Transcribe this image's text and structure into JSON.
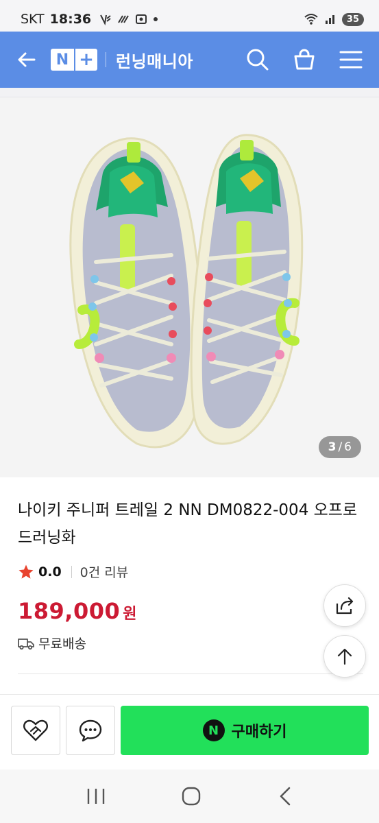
{
  "status_bar": {
    "carrier": "SKT",
    "time": "18:36",
    "battery": "35"
  },
  "header": {
    "logo_n": "N",
    "logo_plus": "+",
    "store_name": "런닝매니아",
    "icons": [
      "back-arrow-icon",
      "search-icon",
      "cart-icon",
      "menu-icon"
    ]
  },
  "gallery": {
    "current": "3",
    "separator": "/",
    "total": "6"
  },
  "product": {
    "title": "나이키 주니퍼 트레일 2 NN DM0822-004 오프로드러닝화",
    "rating": "0.0",
    "review_count": "0건 리뷰",
    "price": "189,000",
    "price_unit": "원",
    "shipping": "무료배송"
  },
  "actions": {
    "buy_label": "구매하기",
    "npay_badge": "N"
  },
  "colors": {
    "header_bg": "#5b8de5",
    "price": "#cc1a33",
    "buy_button": "#22e05a",
    "star": "#e8432e"
  }
}
